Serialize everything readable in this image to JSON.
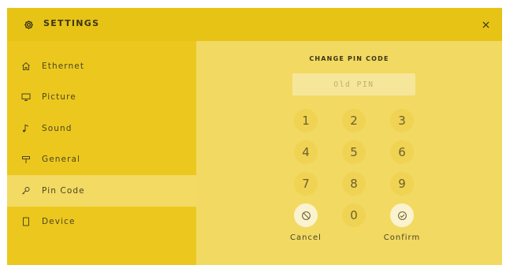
{
  "window": {
    "title": "SETTINGS",
    "colors": {
      "accent": "#ecc81e",
      "panel": "#f2d962",
      "active": "#f2da63",
      "text": "#3b3513"
    }
  },
  "sidebar": {
    "items": [
      {
        "label": "Ethernet",
        "icon": "home-icon"
      },
      {
        "label": "Picture",
        "icon": "monitor-icon"
      },
      {
        "label": "Sound",
        "icon": "music-note-icon"
      },
      {
        "label": "General",
        "icon": "signpost-icon"
      },
      {
        "label": "Pin Code",
        "icon": "key-icon",
        "active": true
      },
      {
        "label": "Device",
        "icon": "tablet-icon"
      }
    ]
  },
  "main": {
    "title": "CHANGE PIN CODE",
    "pin_input": {
      "placeholder": "Old PIN",
      "value": ""
    },
    "keypad": {
      "digits": [
        "1",
        "2",
        "3",
        "4",
        "5",
        "6",
        "7",
        "8",
        "9",
        "0"
      ],
      "cancel_label": "Cancel",
      "confirm_label": "Confirm"
    }
  }
}
